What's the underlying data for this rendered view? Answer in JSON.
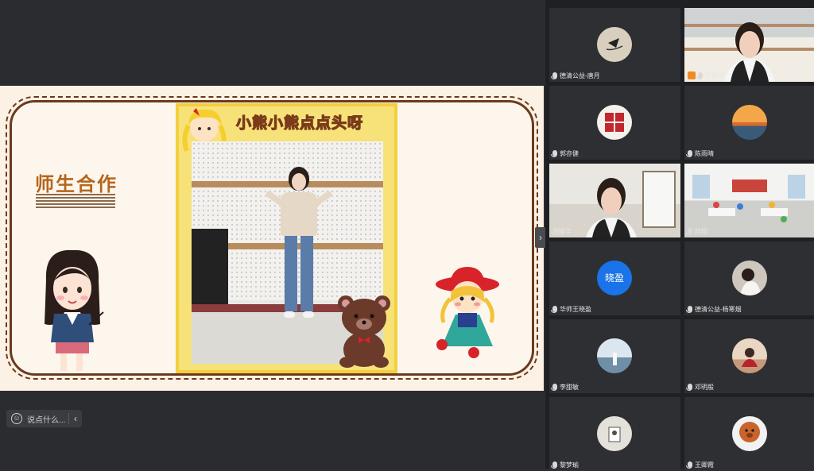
{
  "slide": {
    "section_title": "师生合作",
    "song_title": "小熊小熊点点头呀"
  },
  "chat": {
    "placeholder": "说点什么...",
    "emoji_icon": "smiley-icon",
    "collapse_icon": "chevron-left-icon"
  },
  "panel_toggle_icon": "chevron-right-icon",
  "participants": [
    {
      "name": "德清公益-唐月",
      "kind": "avatar",
      "avatar_color": "#d9cfbf",
      "avatar_glyph": ""
    },
    {
      "name": "刘振华",
      "kind": "camera",
      "host": true
    },
    {
      "name": "郭亦健",
      "kind": "avatar",
      "avatar_color": "#f4f1ec",
      "avatar_glyph": ""
    },
    {
      "name": "陈雨晴",
      "kind": "avatar",
      "avatar_color": "#f0a44a",
      "avatar_glyph": ""
    },
    {
      "name": "刘振华",
      "kind": "camera",
      "active": true
    },
    {
      "name": "陆翔",
      "kind": "camera"
    },
    {
      "name": "华师王晓盈",
      "kind": "avatar",
      "avatar_color": "#1a73e8",
      "avatar_glyph": "晓盈"
    },
    {
      "name": "德清公益-杨寒烟",
      "kind": "avatar",
      "avatar_color": "#cfc7bd",
      "avatar_glyph": ""
    },
    {
      "name": "李甜敏",
      "kind": "avatar",
      "avatar_color": "#9fb4c7",
      "avatar_glyph": ""
    },
    {
      "name": "邓明般",
      "kind": "avatar",
      "avatar_color": "#d2b8a3",
      "avatar_glyph": ""
    },
    {
      "name": "黎梦瑜",
      "kind": "avatar",
      "avatar_color": "#e4e0da",
      "avatar_glyph": ""
    },
    {
      "name": "王卿霞",
      "kind": "avatar",
      "avatar_color": "#c9642c",
      "avatar_glyph": ""
    }
  ]
}
